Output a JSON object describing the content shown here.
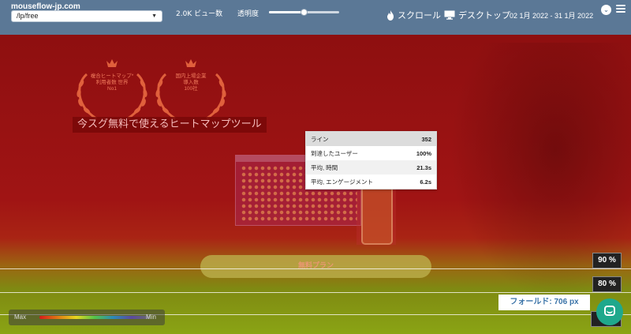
{
  "header": {
    "site": "mouseflow-jp.com",
    "url_value": "/lp/free",
    "views": "2.0K ビュー数",
    "opacity_label": "透明度",
    "opacity_value": 0.5,
    "scroll_label": "スクロール",
    "device_label": "デスクトップ",
    "date_range": "02 1月 2022 - 31 1月 2022"
  },
  "page": {
    "award_left": {
      "line1": "複合ヒートマップ*",
      "line2": "利用者数 世界",
      "line3": "No1"
    },
    "award_right": {
      "line1": "国内上場企業",
      "line2": "導入数",
      "line3": "100社"
    },
    "headline": "今スグ無料で使えるヒートマップツール",
    "cta": "無料プラン"
  },
  "tooltip": {
    "rows": [
      {
        "label": "ライン",
        "value": "352"
      },
      {
        "label": "到達したユーザー",
        "value": "100%"
      },
      {
        "label": "平均, 時間",
        "value": "21.3s"
      },
      {
        "label": "平均, エンゲージメント",
        "value": "6.2s"
      }
    ]
  },
  "markers": {
    "m90": "90 %",
    "m80": "80 %"
  },
  "fold": "フォールド: 706 px",
  "legend": {
    "max": "Max",
    "min": "Min"
  },
  "icons": {
    "scroll": "fire-icon",
    "device": "monitor-icon",
    "toggle": "chevron-down-icon",
    "menu": "hamburger-menu-icon",
    "chat": "chat-icon"
  },
  "colors": {
    "toolbar": "#5b7896",
    "fold_text": "#3b74a8",
    "chat": "#1fa88c"
  }
}
